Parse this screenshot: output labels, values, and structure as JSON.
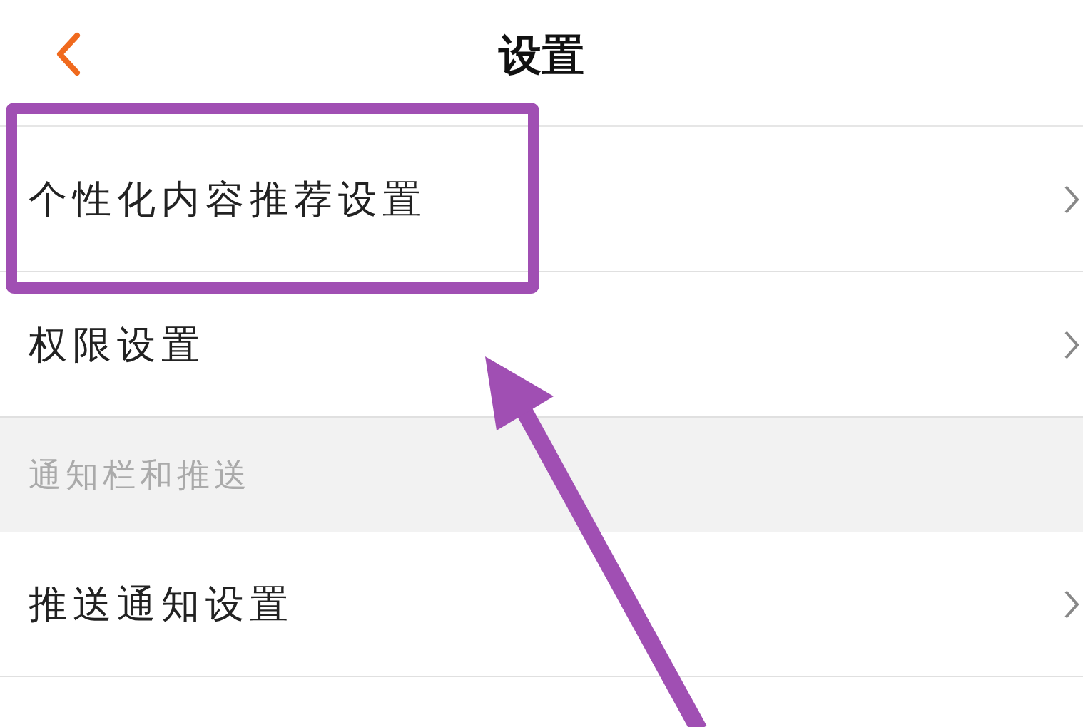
{
  "header": {
    "title": "设置"
  },
  "sections": [
    {
      "kind": "group",
      "items": [
        {
          "label": "个性化内容推荐设置"
        },
        {
          "label": "权限设置"
        }
      ]
    },
    {
      "kind": "heading",
      "title": "通知栏和推送"
    },
    {
      "kind": "group",
      "items": [
        {
          "label": "推送通知设置"
        }
      ]
    }
  ]
}
